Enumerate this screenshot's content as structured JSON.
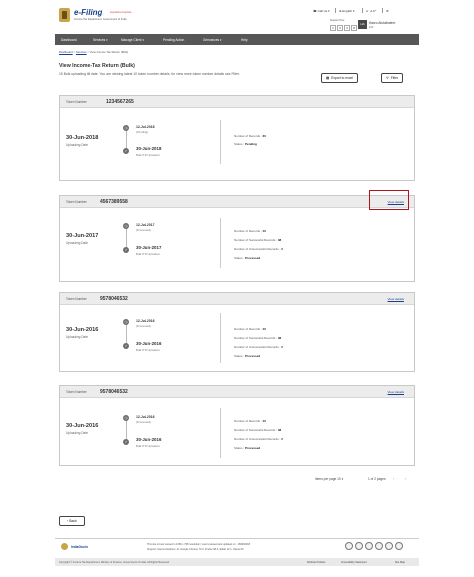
{
  "header": {
    "brand_title": "e-Filing",
    "brand_tagline": "Anywhere Anytime",
    "brand_dept": "Income Tax Department, Government of India",
    "call_us": "Call Us",
    "language": "English",
    "session_label": "Session Time",
    "session_digits": [
      "1",
      "4",
      "3",
      "8"
    ],
    "user_initials": "HA",
    "user_name": "Hasro Abdulhatem",
    "user_role": "ERI"
  },
  "nav": {
    "items": [
      "Dashboard",
      "Services",
      "Manage Client",
      "Pending Action",
      "Grievances",
      "Help"
    ]
  },
  "breadcrumb": {
    "items": [
      "Dashboard",
      "Services"
    ],
    "current": "View Income Tax Return (Bulk)"
  },
  "page": {
    "title": "View Income-Tax Return (Bulk)",
    "description": "15 Bulk uploading till date. You are viewing latest 10 token number details, for view more token number details use Filter.",
    "export_label": "Export to excel",
    "filter_label": "Filter"
  },
  "cards": [
    {
      "token_label": "Token Number",
      "token_number": "1234567265",
      "upload_date": "30-Jun-2018",
      "upload_date_label": "Uploading Date",
      "step1_date": "12-Jul-2018",
      "step1_status": "(Pending)",
      "step2_date": "30-Jun-2018",
      "step2_status": "Bulk ITR Uploaded",
      "stats": [
        {
          "label": "Number of Records",
          "value": "30"
        },
        {
          "label": "Status",
          "value": "Pending"
        }
      ]
    },
    {
      "token_label": "Token Number",
      "token_number": "4567389558",
      "view_details": "View details",
      "upload_date": "30-Jun-2017",
      "upload_date_label": "Uploading Date",
      "step1_date": "12-Jul-2017",
      "step1_status": "(Processed)",
      "step2_date": "30-Jun-2017",
      "step2_status": "Bulk ITR Uploaded",
      "stats": [
        {
          "label": "Number of Records",
          "value": "40"
        },
        {
          "label": "Number of Successful Records",
          "value": "38"
        },
        {
          "label": "Number of Unsuccessful Records",
          "value": "2"
        },
        {
          "label": "Status",
          "value": "Processed"
        }
      ]
    },
    {
      "token_label": "Token Number",
      "token_number": "9578046532",
      "view_details": "View details",
      "upload_date": "30-Jun-2016",
      "upload_date_label": "Uploading Date",
      "step1_date": "12-Jul-2016",
      "step1_status": "(Processed)",
      "step2_date": "30-Jun-2016",
      "step2_status": "Bulk ITR Uploaded",
      "stats": [
        {
          "label": "Number of Records",
          "value": "40"
        },
        {
          "label": "Number of Successful Records",
          "value": "38"
        },
        {
          "label": "Number of Unsuccessful Records",
          "value": "2"
        },
        {
          "label": "Status",
          "value": "Processed"
        }
      ]
    },
    {
      "token_label": "Token Number",
      "token_number": "9578046532",
      "view_details": "View details",
      "upload_date": "30-Jun-2016",
      "upload_date_label": "Uploading Date",
      "step1_date": "12-Jul-2016",
      "step1_status": "(Processed)",
      "step2_date": "30-Jun-2016",
      "step2_status": "Bulk ITR Uploaded",
      "stats": [
        {
          "label": "Number of Records",
          "value": "40"
        },
        {
          "label": "Number of Successful Records",
          "value": "38"
        },
        {
          "label": "Number of Unsuccessful Records",
          "value": "2"
        },
        {
          "label": "Status",
          "value": "Processed"
        }
      ]
    }
  ],
  "pagination": {
    "items_per_page_label": "Items per page",
    "items_per_page": "10",
    "range": "1 of 2 pages"
  },
  "back_label": "Back",
  "footer": {
    "logo_text": "IndiaGov.in",
    "note1": "This site is best viewed in 1366 x 768 resolution | Last reviewed and updated on : 18/08/2018",
    "note2": "Support: Internet Explorer 11, Google Chrome 70.0, Firefox 68.0, Safari 12.1, Opera 60",
    "copyright": "Copyright © Income Tax Department, Ministry of Finance, Government of India. All Rights Reserved",
    "links": [
      "Website Policies",
      "Accessibility Statement",
      "Site Map"
    ]
  },
  "colors": {
    "navbar": "#575757",
    "brand_blue": "#1a3f8f",
    "highlight_red": "#b3131a"
  }
}
